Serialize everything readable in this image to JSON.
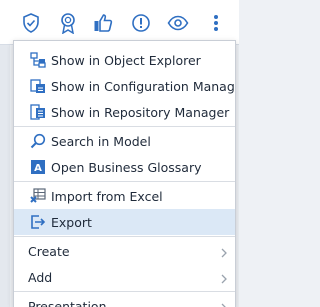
{
  "toolbar": {
    "icons": [
      "shield-check-icon",
      "award-ribbon-icon",
      "thumbs-up-icon",
      "alert-circle-icon",
      "eye-icon",
      "more-vertical-icon"
    ],
    "accent": "#2f6fc2"
  },
  "menu": {
    "groups": [
      [
        {
          "label": "Show in Object Explorer",
          "icon": "object-explorer-icon"
        },
        {
          "label": "Show in Configuration Manager",
          "icon": "configuration-manager-icon"
        },
        {
          "label": "Show in Repository Manager",
          "icon": "repository-manager-icon"
        }
      ],
      [
        {
          "label": "Search in Model",
          "icon": "search-icon"
        },
        {
          "label": "Open Business Glossary",
          "icon": "glossary-icon"
        }
      ],
      [
        {
          "label": "Import from Excel",
          "icon": "import-excel-icon"
        },
        {
          "label": "Export",
          "icon": "export-icon",
          "highlighted": true
        }
      ],
      [
        {
          "label": "Create",
          "submenu": true
        },
        {
          "label": "Add",
          "submenu": true
        }
      ],
      [
        {
          "label": "Presentation",
          "submenu": true
        }
      ]
    ],
    "highlight_color": "#dbe8f6",
    "text_color": "#1f2a3a"
  }
}
